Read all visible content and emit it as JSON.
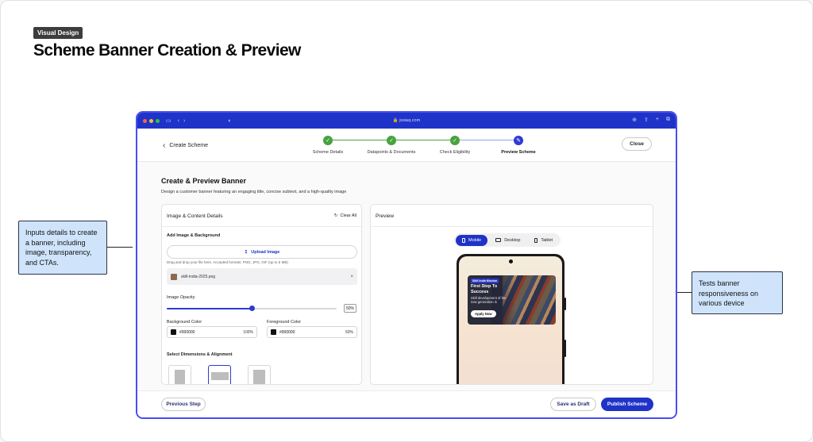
{
  "page": {
    "tag": "Visual Design",
    "title": "Scheme Banner Creation & Preview"
  },
  "callouts": {
    "left": "Inputs details to create a banner, including image, transparency, and CTAs.",
    "right": "Tests banner responsiveness on various device"
  },
  "browser": {
    "url": "jssiaq.com",
    "colors": {
      "chrome": "#1f33c8",
      "accent": "#2d3bd1",
      "done": "#46a33d"
    }
  },
  "topbar": {
    "back_label": "Create Scheme",
    "close_label": "Close",
    "steps": [
      {
        "label": "Scheme Details",
        "state": "done"
      },
      {
        "label": "Datapoints & Documents",
        "state": "done"
      },
      {
        "label": "Check Eligibility",
        "state": "done"
      },
      {
        "label": "Preview Scheme",
        "state": "active"
      }
    ]
  },
  "main": {
    "title": "Create & Preview Banner",
    "subtitle": "Design a customer banner featuring an engaging title, concise subtext, and a high-quality image"
  },
  "details": {
    "title": "Image & Content Details",
    "clear_label": "Clear All",
    "add_image_label": "Add Image & Background",
    "upload_label": "Upload Image",
    "hint": "Drag and drop your file here. Accepted formats: PNG, JPG, GIF (up to 5 MB)",
    "file_name": "skill-india-2025.png",
    "opacity_label": "Image Opacity",
    "opacity_value": "50%",
    "opacity_fraction": 0.5,
    "bg_color_label": "Background Color",
    "bg_color_value": "#000000",
    "bg_color_pct": "100%",
    "fg_color_label": "Foreground Color",
    "fg_color_value": "#000000",
    "fg_color_pct": "50%",
    "dimensions_label": "Select Dimensions & Alignment"
  },
  "preview": {
    "title": "Preview",
    "tabs": [
      "Mobile",
      "Desktop",
      "Tablet"
    ],
    "selected_tab": "Mobile",
    "banner": {
      "tag": "Skill India Mission",
      "title": "First Step To Success",
      "subtitle": "Skill development of the new generation is",
      "cta": "Apply Now"
    }
  },
  "footer": {
    "previous_label": "Previous Step",
    "draft_label": "Save as Draft",
    "publish_label": "Publish Scheme"
  }
}
